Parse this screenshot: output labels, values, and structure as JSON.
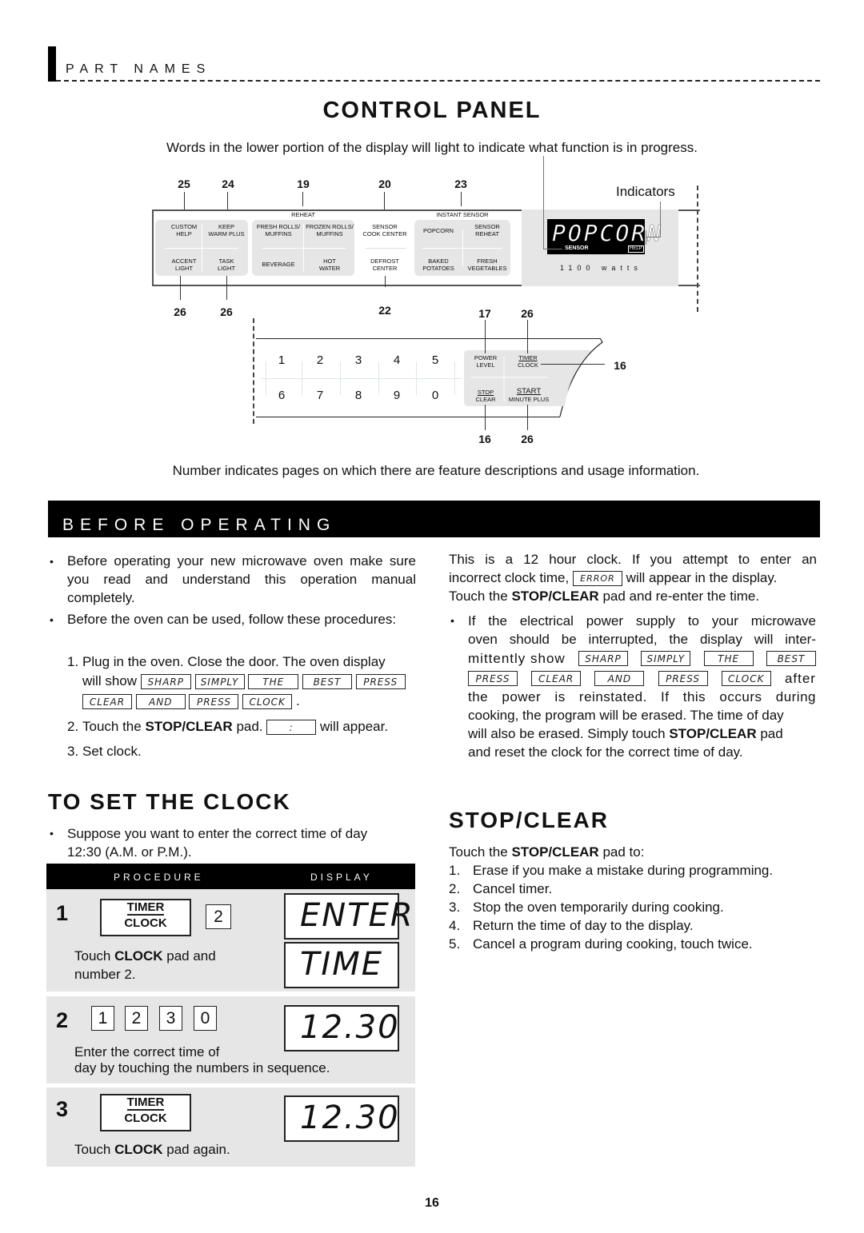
{
  "section_header": "PART NAMES",
  "control_panel": {
    "title": "CONTROL PANEL",
    "intro": "Words in the lower portion of the display will light to indicate what function is in progress.",
    "indicators_label": "Indicators",
    "top_callouts": [
      "25",
      "24",
      "19",
      "20",
      "23"
    ],
    "bottom_callouts": [
      "26",
      "26",
      "22"
    ],
    "group_titles": {
      "reheat": "REHEAT",
      "instant_sensor": "INSTANT SENSOR"
    },
    "pads": {
      "custom_help": "CUSTOM\nHELP",
      "keep_warm_plus": "KEEP\nWARM PLUS",
      "accent_light": "ACCENT\nLIGHT",
      "task_light": "TASK\nLIGHT",
      "fresh_rolls": "FRESH ROLLS/\nMUFFINS",
      "frozen_rolls": "FROZEN ROLLS/\nMUFFINS",
      "beverage": "BEVERAGE",
      "hot_water": "HOT\nWATER",
      "sensor_cook_center": "SENSOR\nCOOK CENTER",
      "defrost_center": "DEFROST\nCENTER",
      "popcorn": "POPCORN",
      "sensor_reheat": "SENSOR\nREHEAT",
      "baked_potatoes": "BAKED\nPOTATOES",
      "fresh_vegetables": "FRESH\nVEGETABLES"
    },
    "display": {
      "text": "POPCORN",
      "sensor": "SENSOR",
      "help": "HELP",
      "watts": "1100 watts"
    },
    "keypad": [
      "1",
      "2",
      "3",
      "4",
      "5",
      "6",
      "7",
      "8",
      "9",
      "0"
    ],
    "function_pads": {
      "power_level": "POWER\nLEVEL",
      "timer": "TIMER",
      "clock": "CLOCK",
      "stop": "STOP",
      "clear": "CLEAR",
      "start": "START",
      "minute_plus": "MINUTE PLUS"
    },
    "lower_callouts": {
      "power_level": "17",
      "timer_clock_top": "26",
      "timer_clock_side": "16",
      "stop_clear": "16",
      "start": "26"
    },
    "footnote": "Number indicates pages on which there are feature descriptions and usage information."
  },
  "before_operating": {
    "title": "BEFORE OPERATING",
    "bullets": [
      "Before operating your new microwave oven make sure you read and understand this operation manual completely.",
      "Before the oven can be used, follow these procedures:"
    ],
    "steps": [
      {
        "num": "1.",
        "text": "Plug in the oven. Close the door. The oven display",
        "text2": "will show"
      },
      {
        "num": "2.",
        "pre": "Touch the ",
        "bold": "STOP/CLEAR",
        "post": " pad.",
        "after": "will appear."
      },
      {
        "num": "3.",
        "text": "Set clock."
      }
    ],
    "display_words": [
      "SHARP",
      "SIMPLY",
      "THE",
      "BEST",
      "PRESS",
      "CLEAR",
      "AND",
      "PRESS",
      "CLOCK"
    ],
    "colon_display": ":",
    "right": {
      "p1a": "This is a 12 hour clock. If you attempt to enter an",
      "p1b_pre": "incorrect clock time,",
      "error_word": "ERROR",
      "p1b_post": "will appear in the display.",
      "p1c_pre": "Touch the ",
      "p1c_bold": "STOP/CLEAR",
      "p1c_post": " pad and re-enter the time.",
      "bullet_a": "If the electrical power supply to your microwave",
      "bullet_b": "oven should be interrupted, the display will inter-",
      "bullet_c": "mittently show",
      "after": "after",
      "bullet_d": "the power is reinstated. If this occurs during",
      "bullet_e": "cooking, the program will be erased. The time of day",
      "bullet_f_pre": "will also be erased. Simply touch ",
      "bullet_f_bold": "STOP/CLEAR",
      "bullet_f_post": " pad",
      "bullet_g": "and reset the clock for the correct time of day."
    }
  },
  "set_clock": {
    "title": "TO SET THE CLOCK",
    "bullet_a": "Suppose you want to enter the correct time of day",
    "bullet_b": "12:30 (A.M. or P.M.).",
    "table_header": {
      "procedure": "PROCEDURE",
      "display": "DISPLAY"
    },
    "steps": [
      {
        "num": "1",
        "pad_top": "TIMER",
        "pad_bottom": "CLOCK",
        "digit": "2",
        "text_pre": "Touch ",
        "text_bold": "CLOCK",
        "text_post": " pad and",
        "text2": "number 2.",
        "displays": [
          "ENTER",
          "TIME"
        ]
      },
      {
        "num": "2",
        "digits": [
          "1",
          "2",
          "3",
          "0"
        ],
        "text1": "Enter the correct time of",
        "text2": "day by touching the numbers in sequence.",
        "displays": [
          "12.30"
        ]
      },
      {
        "num": "3",
        "pad_top": "TIMER",
        "pad_bottom": "CLOCK",
        "text_pre": "Touch ",
        "text_bold": "CLOCK",
        "text_post": " pad again.",
        "displays": [
          "12.30"
        ]
      }
    ]
  },
  "stop_clear": {
    "title": "STOP/CLEAR",
    "intro_pre": "Touch the ",
    "intro_bold": "STOP/CLEAR",
    "intro_post": " pad to:",
    "items": [
      {
        "num": "1.",
        "text": "Erase if you make a mistake during programming."
      },
      {
        "num": "2.",
        "text": "Cancel timer."
      },
      {
        "num": "3.",
        "text": "Stop the oven temporarily during cooking."
      },
      {
        "num": "4.",
        "text": "Return the time of day to the display."
      },
      {
        "num": "5.",
        "text": "Cancel a program during cooking, touch twice."
      }
    ]
  },
  "page_number": "16"
}
